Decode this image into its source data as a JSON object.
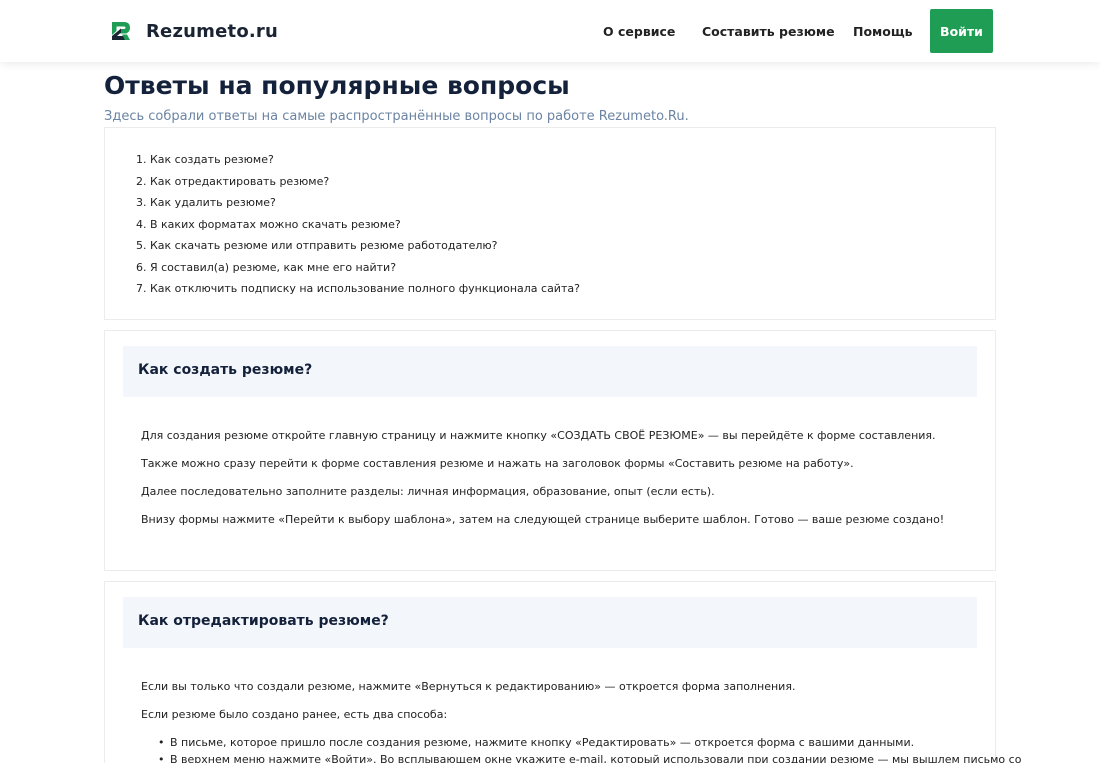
{
  "header": {
    "logo_text": "Rezumeto.ru",
    "nav": [
      "О сервисе",
      "Составить резюме",
      "Помощь"
    ],
    "login_label": "Войти",
    "accent_color": "#1f9d55"
  },
  "page": {
    "title": "Ответы на популярные вопросы",
    "subtitle": "Здесь собрали ответы на самые распространённые вопросы по работе Rezumeto.Ru."
  },
  "toc": [
    "1. Как создать резюме?",
    "2. Как отредактировать резюме?",
    "3. Как удалить резюме?",
    "4. В каких форматах можно скачать резюме?",
    "5. Как скачать резюме или отправить резюме работодателю?",
    "6. Я составил(а) резюме, как мне его найти?",
    "7. Как отключить подписку на использование полного функционала сайта?"
  ],
  "sections": [
    {
      "title": "Как создать резюме?",
      "paragraphs": [
        "Для создания резюме откройте главную страницу и нажмите кнопку «СОЗДАТЬ СВОЁ РЕЗЮМЕ» — вы перейдёте к форме составления.",
        "Также можно сразу перейти к форме составления резюме и нажать на заголовок формы «Составить резюме на работу».",
        "Далее последовательно заполните разделы: личная информация, образование, опыт (если есть).",
        "Внизу формы нажмите «Перейти к выбору шаблона», затем на следующей странице выберите шаблон. Готово — ваше резюме создано!"
      ]
    },
    {
      "title": "Как отредактировать резюме?",
      "paragraphs": [
        "Если вы только что создали резюме, нажмите «Вернуться к редактированию» — откроется форма заполнения.",
        "Если резюме было создано ранее, есть два способа:"
      ],
      "bullets": [
        "В письме, которое пришло после создания резюме, нажмите кнопку «Редактировать» — откроется форма с вашими данными.",
        "В верхнем меню нажмите «Войти». Во всплывающем окне укажите e-mail, который использовали при создании резюме — мы вышлем письмо со"
      ]
    }
  ]
}
